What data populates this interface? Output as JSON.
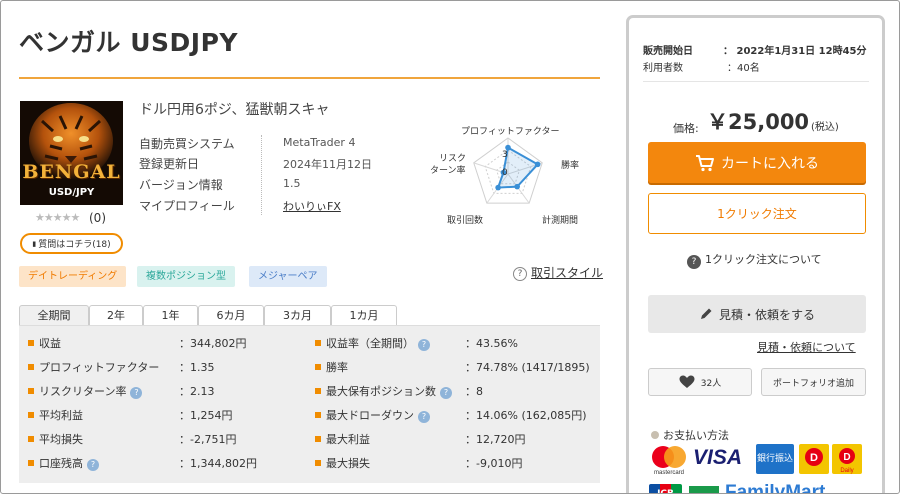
{
  "product": {
    "title": "ベンガル USDJPY",
    "catchphrase": "ドル円用6ポジ、猛獣朝スキャ",
    "logo_text": "BENGAL",
    "logo_subtext": "USD/JPY",
    "rating_stars": "★★★★★",
    "rating_count": "(0)",
    "question_label": "質問はコチラ(18)",
    "info": [
      {
        "label": "自動売買システム",
        "value": "MetaTrader 4"
      },
      {
        "label": "登録更新日",
        "value": "2024年11月12日"
      },
      {
        "label": "バージョン情報",
        "value": "1.5"
      },
      {
        "label": "マイプロフィール",
        "value": "わいりぃFX"
      }
    ],
    "tags": [
      "デイトレーディング",
      "複数ポジション型",
      "メジャーペア"
    ],
    "trade_style_link": "取引スタイル"
  },
  "radar": {
    "labels": {
      "profit_factor": "プロフィットファクター",
      "win_rate": "勝率",
      "period": "計測期間",
      "trades": "取引回数",
      "risk_return": "リスク\nターン率"
    },
    "label_risk_1": "リスク",
    "label_risk_2": "ターン率",
    "scale_max": "3",
    "scale_zero": "0",
    "values": [
      2.2,
      2.6,
      1.3,
      1.4,
      0.4
    ],
    "line_color": "#3a8fd6"
  },
  "tabs": [
    "全期間",
    "2年",
    "1年",
    "6カ月",
    "3カ月",
    "1カ月"
  ],
  "active_tab": "全期間",
  "stats_left": [
    {
      "label": "収益",
      "value": "：344,802円",
      "help": false
    },
    {
      "label": "プロフィットファクター",
      "value": "：1.35",
      "help": false
    },
    {
      "label": "リスクリターン率",
      "value": "：2.13",
      "help": true
    },
    {
      "label": "平均利益",
      "value": "：1,254円",
      "help": false
    },
    {
      "label": "平均損失",
      "value": "：-2,751円",
      "help": false
    },
    {
      "label": "口座残高",
      "value": "：1,344,802円",
      "help": true
    }
  ],
  "stats_right": [
    {
      "label": "収益率（全期間）",
      "value": "：43.56%",
      "help": true
    },
    {
      "label": "勝率",
      "value": "：74.78% (1417/1895)",
      "help": false
    },
    {
      "label": "最大保有ポジション数",
      "value": "：8",
      "help": true
    },
    {
      "label": "最大ドローダウン",
      "value": "：14.06% (162,085円)",
      "help": true
    },
    {
      "label": "最大利益",
      "value": "：12,720円",
      "help": false
    },
    {
      "label": "最大損失",
      "value": "：-9,010円",
      "help": false
    }
  ],
  "sidebar": {
    "sale_start_label": "販売開始日",
    "sale_start_value": "：  2022年1月31日 12時45分",
    "users_label": "利用者数",
    "users_value": "：40名",
    "price_label": "価格:",
    "price_value": "￥25,000",
    "price_tax": "(税込)",
    "cart_button": "カートに入れる",
    "oneclick_button": "1クリック注文",
    "oneclick_about": "1クリック注文について",
    "estimate_button": "見積・依頼をする",
    "estimate_about": "見積・依頼について",
    "favorite_count": "32人",
    "portfolio_button": "ポートフォリオ追加",
    "payment_title": "お支払い方法",
    "payment_logos": [
      "mastercard",
      "VISA",
      "銀行振込",
      "Docomo",
      "Daily",
      "JCB",
      "FamilyMart"
    ]
  },
  "colors": {
    "accent": "#f3870d",
    "title_rule": "#f0a53c",
    "stat_bg": "#eeeeee"
  }
}
